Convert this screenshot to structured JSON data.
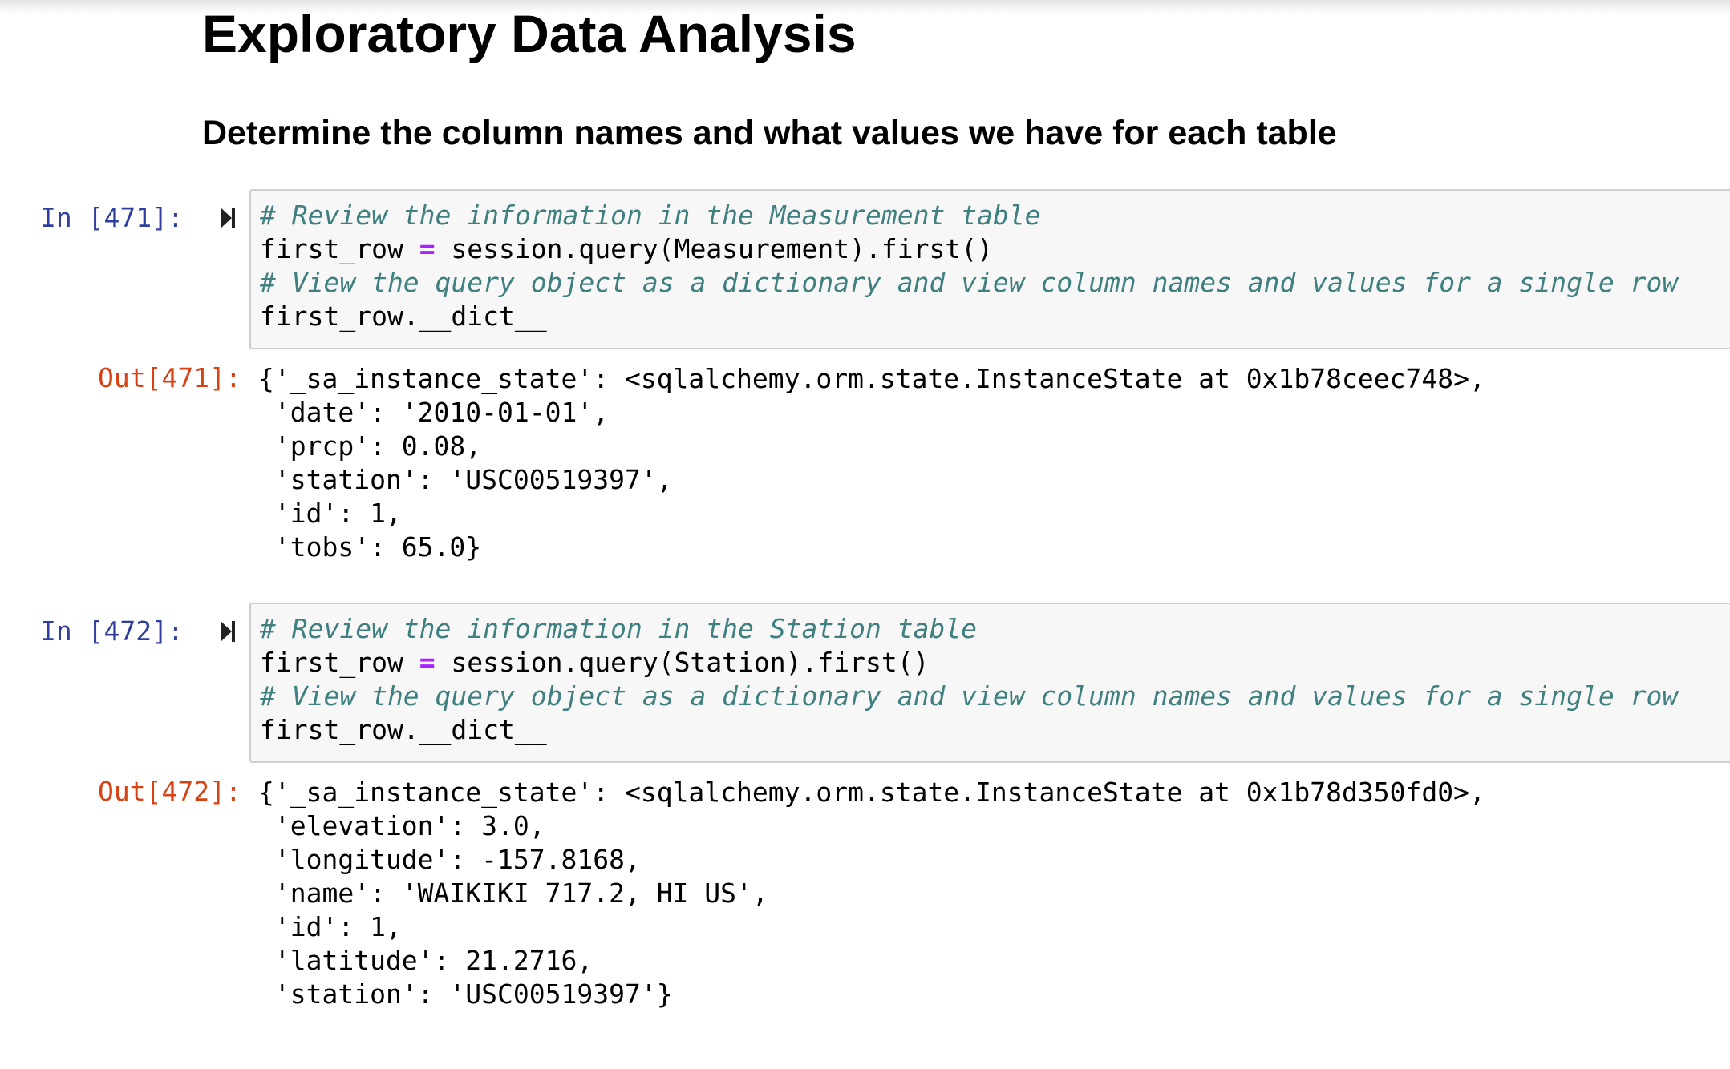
{
  "notebook": {
    "heading": "Exploratory Data Analysis",
    "subheading": "Determine the column names and what values we have for each table",
    "cells": [
      {
        "in_prompt": "In [471]:",
        "code": {
          "line1": "# Review the information in the Measurement table",
          "line2_a": "first_row ",
          "line2_op": "=",
          "line2_b": " session.query(Measurement).first()",
          "line3": "# View the query object as a dictionary and view column names and values for a single row",
          "line4": "first_row.__dict__"
        },
        "out_prompt": "Out[471]:",
        "output": [
          "{'_sa_instance_state': <sqlalchemy.orm.state.InstanceState at 0x1b78ceec748>,",
          " 'date': '2010-01-01',",
          " 'prcp': 0.08,",
          " 'station': 'USC00519397',",
          " 'id': 1,",
          " 'tobs': 65.0}"
        ]
      },
      {
        "in_prompt": "In [472]:",
        "code": {
          "line1": "# Review the information in the Station table",
          "line2_a": "first_row ",
          "line2_op": "=",
          "line2_b": " session.query(Station).first()",
          "line3": "# View the query object as a dictionary and view column names and values for a single row",
          "line4": "first_row.__dict__"
        },
        "out_prompt": "Out[472]:",
        "output": [
          "{'_sa_instance_state': <sqlalchemy.orm.state.InstanceState at 0x1b78d350fd0>,",
          " 'elevation': 3.0,",
          " 'longitude': -157.8168,",
          " 'name': 'WAIKIKI 717.2, HI US',",
          " 'id': 1,",
          " 'latitude': 21.2716,",
          " 'station': 'USC00519397'}"
        ]
      }
    ]
  },
  "icons": {
    "run": "run-cell-icon"
  },
  "colors": {
    "in_prompt": "#303f9f",
    "out_prompt": "#d84315",
    "comment": "#408080",
    "operator": "#aa22ff",
    "cell_background": "#f7f7f7",
    "cell_border": "#cfcfcf"
  }
}
